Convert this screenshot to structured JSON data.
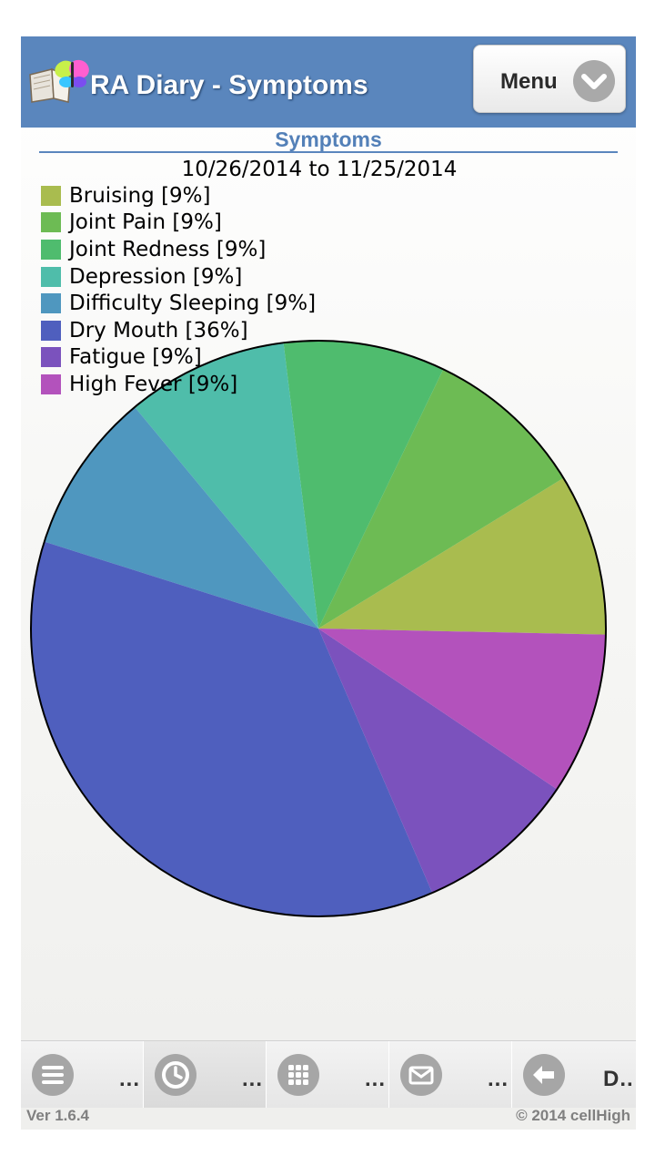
{
  "header": {
    "title": "RA Diary - Symptoms",
    "menu_label": "Menu",
    "menu_icon": "chevron-down-circle-icon",
    "logo_icon": "book-butterfly-logo"
  },
  "chart_data": {
    "type": "pie",
    "title": "Symptoms",
    "subtitle": "10/26/2014 to 11/25/2014",
    "legend_position": "top-left",
    "slices": [
      {
        "label": "Bruising [9%]",
        "value": 9,
        "color": "#a9bc4f"
      },
      {
        "label": "Joint Pain [9%]",
        "value": 9,
        "color": "#6dbb54"
      },
      {
        "label": "Joint Redness [9%]",
        "value": 9,
        "color": "#4fbc6e"
      },
      {
        "label": "Depression [9%]",
        "value": 9,
        "color": "#4fbdaa"
      },
      {
        "label": "Difficulty Sleeping [9%]",
        "value": 9,
        "color": "#4f97bf"
      },
      {
        "label": "Dry Mouth [36%]",
        "value": 36,
        "color": "#4f5fbe"
      },
      {
        "label": "Fatigue [9%]",
        "value": 9,
        "color": "#7b52bd"
      },
      {
        "label": "High Fever [9%]",
        "value": 9,
        "color": "#b352bc"
      }
    ]
  },
  "bottom_nav": {
    "items": [
      {
        "icon": "list-menu-icon",
        "label": "..."
      },
      {
        "icon": "clock-icon",
        "label": "..."
      },
      {
        "icon": "grid-icon",
        "label": "..."
      },
      {
        "icon": "mail-icon",
        "label": "..."
      },
      {
        "icon": "back-arrow-icon",
        "label": "D.."
      }
    ]
  },
  "footer": {
    "version": "Ver 1.6.4",
    "copyright": "© 2014 cellHigh"
  }
}
